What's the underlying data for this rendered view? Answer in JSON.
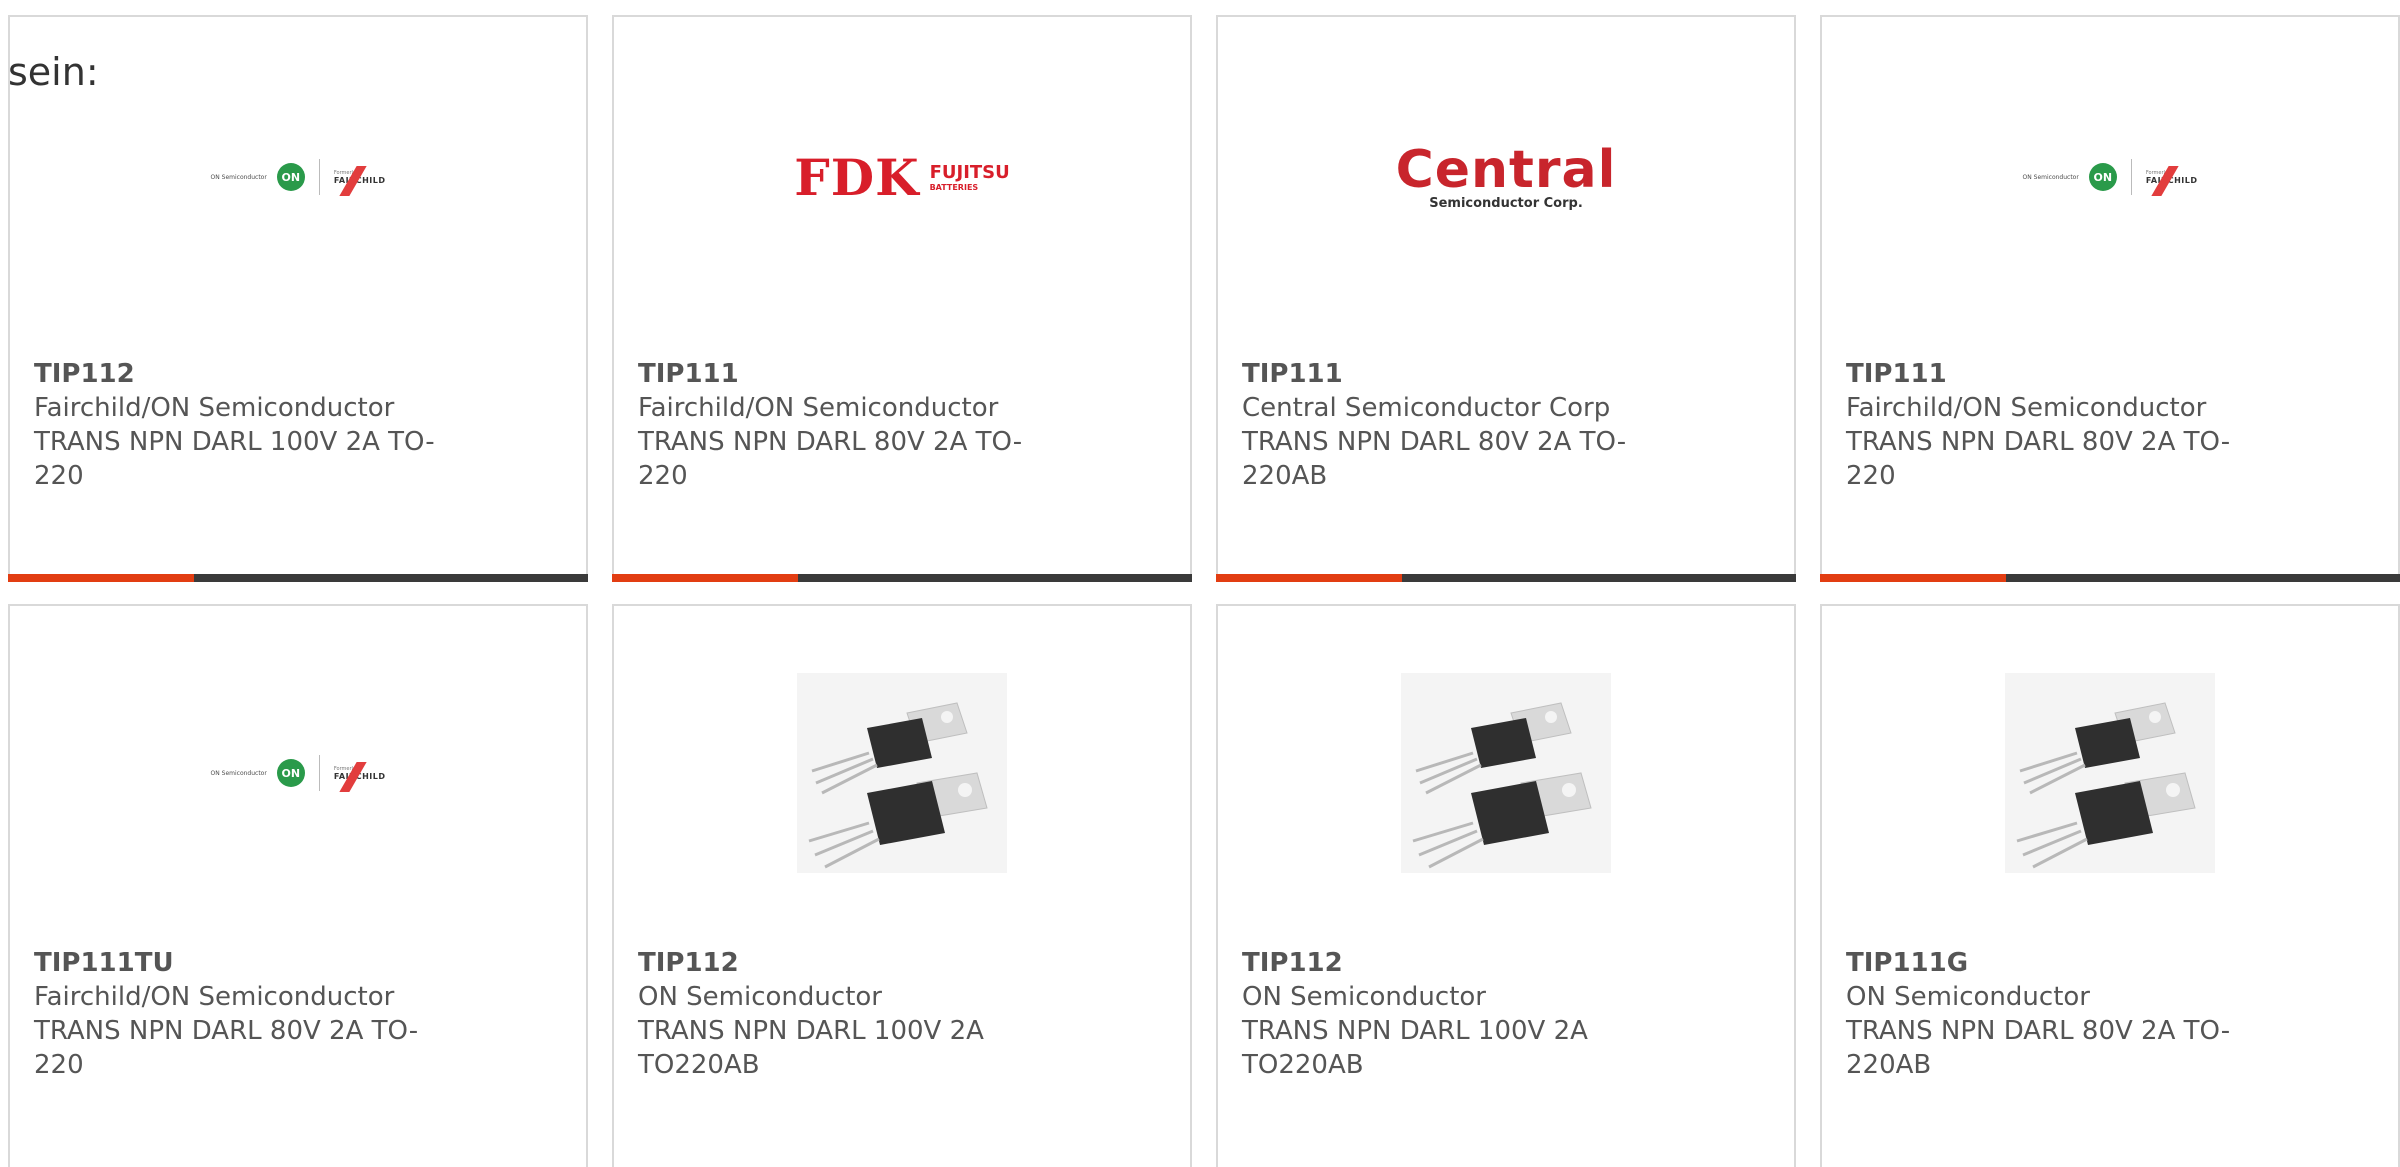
{
  "intro_text": "sein:",
  "cards": [
    {
      "part_number": "TIP112",
      "manufacturer": "Fairchild/ON Semiconductor",
      "description": "TRANS NPN DARL 100V 2A TO-220",
      "image": "on-fairchild-logo",
      "progress_fraction": 0.32
    },
    {
      "part_number": "TIP111",
      "manufacturer": "Fairchild/ON Semiconductor",
      "description": "TRANS NPN DARL 80V 2A TO-220",
      "image": "fdk-fujitsu-logo",
      "progress_fraction": 0.32
    },
    {
      "part_number": "TIP111",
      "manufacturer": "Central Semiconductor Corp",
      "description": "TRANS NPN DARL 80V 2A TO-220AB",
      "image": "central-semiconductor-logo",
      "progress_fraction": 0.32
    },
    {
      "part_number": "TIP111",
      "manufacturer": "Fairchild/ON Semiconductor",
      "description": "TRANS NPN DARL 80V 2A TO-220",
      "image": "on-fairchild-logo",
      "progress_fraction": 0.32
    },
    {
      "part_number": "TIP111TU",
      "manufacturer": "Fairchild/ON Semiconductor",
      "description": "TRANS NPN DARL 80V 2A TO-220",
      "image": "on-fairchild-logo"
    },
    {
      "part_number": "TIP112",
      "manufacturer": "ON Semiconductor",
      "description": "TRANS NPN DARL 100V 2A TO220AB",
      "image": "to220-transistor-photo"
    },
    {
      "part_number": "TIP112",
      "manufacturer": "ON Semiconductor",
      "description": "TRANS NPN DARL 100V 2A TO220AB",
      "image": "to220-transistor-photo"
    },
    {
      "part_number": "TIP111G",
      "manufacturer": "ON Semiconductor",
      "description": "TRANS NPN DARL 80V 2A TO-220AB",
      "image": "to220-transistor-photo"
    }
  ],
  "logos": {
    "onsemi_text": "ON Semiconductor",
    "on_badge": "ON",
    "formerly": "Formerly",
    "fairchild": "FAIRCHILD",
    "fdk": "FDK",
    "fujitsu": "FUJITSU",
    "batteries": "BATTERIES",
    "central": "Central",
    "central_sub": "Semiconductor Corp."
  },
  "colors": {
    "accent": "#e23d12",
    "progress_track": "#3a3a3a",
    "card_border": "#d9d9d9",
    "text": "#555555"
  }
}
